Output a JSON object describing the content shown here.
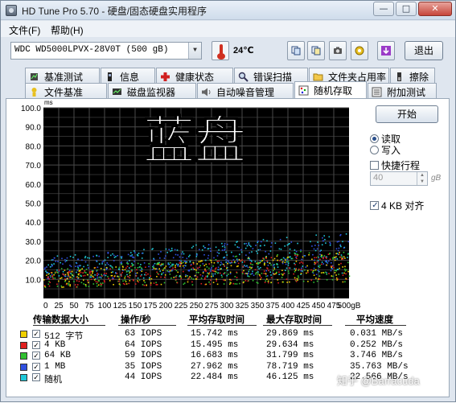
{
  "window": {
    "title": "HD Tune Pro 5.70 - 硬盘/固态硬盘实用程序"
  },
  "menu": {
    "file": "文件(F)",
    "help": "帮助(H)"
  },
  "toolbar": {
    "drive": "WDC WD5000LPVX-28V0T (500 gB)",
    "temperature": "24℃",
    "exit": "退出"
  },
  "tabs_row1": [
    {
      "label": "基准测试",
      "icon": "benchmark-icon"
    },
    {
      "label": "信息",
      "icon": "info-icon"
    },
    {
      "label": "健康状态",
      "icon": "health-cross-icon"
    },
    {
      "label": "错误扫描",
      "icon": "magnifier-icon"
    },
    {
      "label": "文件夹占用率",
      "icon": "folder-icon"
    },
    {
      "label": "擦除",
      "icon": "erase-icon"
    }
  ],
  "tabs_row2": [
    {
      "label": "文件基准",
      "icon": "file-benchmark-icon"
    },
    {
      "label": "磁盘监视器",
      "icon": "monitor-icon"
    },
    {
      "label": "自动噪音管理",
      "icon": "speaker-icon"
    },
    {
      "label": "随机存取",
      "icon": "random-access-icon",
      "active": true
    },
    {
      "label": "附加测试",
      "icon": "extra-tests-icon"
    }
  ],
  "overlay_text": "蓝盘",
  "controls": {
    "start": "开始",
    "read": "读取",
    "write": "写入",
    "short_stroke": "快捷行程",
    "short_stroke_value": "40",
    "short_stroke_unit": "gB",
    "align_4kb": "4 KB 对齐"
  },
  "chart_data": {
    "type": "scatter",
    "ylabel": "ms",
    "xlabel": "",
    "xlim": [
      0,
      500
    ],
    "ylim": [
      0,
      100
    ],
    "x_unit": "gB",
    "y_ticks": [
      "10.0",
      "20.0",
      "30.0",
      "40.0",
      "50.0",
      "60.0",
      "70.0",
      "80.0",
      "90.0",
      "100.0"
    ],
    "x_ticks": [
      "0",
      "25",
      "50",
      "75",
      "100",
      "125",
      "150",
      "175",
      "200",
      "225",
      "250",
      "275",
      "300",
      "325",
      "350",
      "375",
      "400",
      "425",
      "450",
      "475",
      "500gB"
    ],
    "grid": true,
    "series": [
      {
        "name": "512 字节",
        "color": "#f0d000",
        "y_min": 6,
        "y_max": 22
      },
      {
        "name": "4 KB",
        "color": "#e02020",
        "y_min": 6,
        "y_max": 22
      },
      {
        "name": "64 KB",
        "color": "#30c030",
        "y_min": 6,
        "y_max": 24
      },
      {
        "name": "1 MB",
        "color": "#3050e0",
        "y_min": 10,
        "y_max": 32
      },
      {
        "name": "随机",
        "color": "#20c8d8",
        "y_min": 10,
        "y_max": 32
      }
    ]
  },
  "table": {
    "headers": [
      "传输数据大小",
      "操作/秒",
      "平均存取时间",
      "最大存取时间",
      "平均速度"
    ],
    "rows": [
      {
        "name": "512 字节",
        "color": "#f0d000",
        "ops": "63 IOPS",
        "avg": "15.742 ms",
        "max": "29.869 ms",
        "speed": "0.031 MB/s"
      },
      {
        "name": "4 KB",
        "color": "#e02020",
        "ops": "64 IOPS",
        "avg": "15.495 ms",
        "max": "29.634 ms",
        "speed": "0.252 MB/s"
      },
      {
        "name": "64 KB",
        "color": "#30c030",
        "ops": "59 IOPS",
        "avg": "16.683 ms",
        "max": "31.799 ms",
        "speed": "3.746 MB/s"
      },
      {
        "name": "1 MB",
        "color": "#3050e0",
        "ops": "35 IOPS",
        "avg": "27.962 ms",
        "max": "78.719 ms",
        "speed": "35.763 MB/s"
      },
      {
        "name": "随机",
        "color": "#20c8d8",
        "ops": "44 IOPS",
        "avg": "22.484 ms",
        "max": "46.125 ms",
        "speed": "22.566 MB/s"
      }
    ]
  },
  "watermark": "知乎 @Barracuda"
}
